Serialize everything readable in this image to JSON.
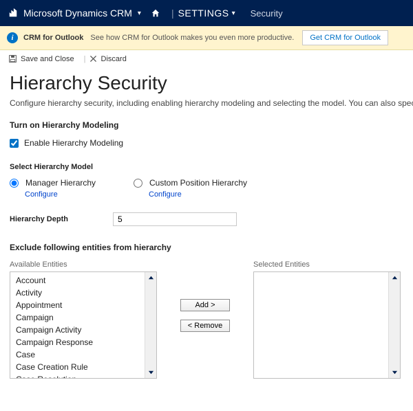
{
  "nav": {
    "brand": "Microsoft Dynamics CRM",
    "settings": "SETTINGS",
    "sub": "Security"
  },
  "notify": {
    "title": "CRM for Outlook",
    "sub": "See how CRM for Outlook makes you even more productive.",
    "button": "Get CRM for Outlook"
  },
  "toolbar": {
    "save": "Save and Close",
    "discard": "Discard"
  },
  "page": {
    "title": "Hierarchy Security",
    "desc": "Configure hierarchy security, including enabling hierarchy modeling and selecting the model. You can also specify h"
  },
  "turnon": {
    "heading": "Turn on Hierarchy Modeling",
    "checkbox": "Enable Hierarchy Modeling",
    "checked": true
  },
  "model": {
    "heading": "Select Hierarchy Model",
    "manager": "Manager Hierarchy",
    "custom": "Custom Position Hierarchy",
    "configure": "Configure",
    "selected": "manager"
  },
  "depth": {
    "label": "Hierarchy Depth",
    "value": "5"
  },
  "exclude": {
    "heading": "Exclude following entities from hierarchy",
    "available_label": "Available Entities",
    "selected_label": "Selected Entities",
    "add": "Add >",
    "remove": "< Remove",
    "available": [
      "Account",
      "Activity",
      "Appointment",
      "Campaign",
      "Campaign Activity",
      "Campaign Response",
      "Case",
      "Case Creation Rule",
      "Case Resolution"
    ],
    "selected": []
  }
}
